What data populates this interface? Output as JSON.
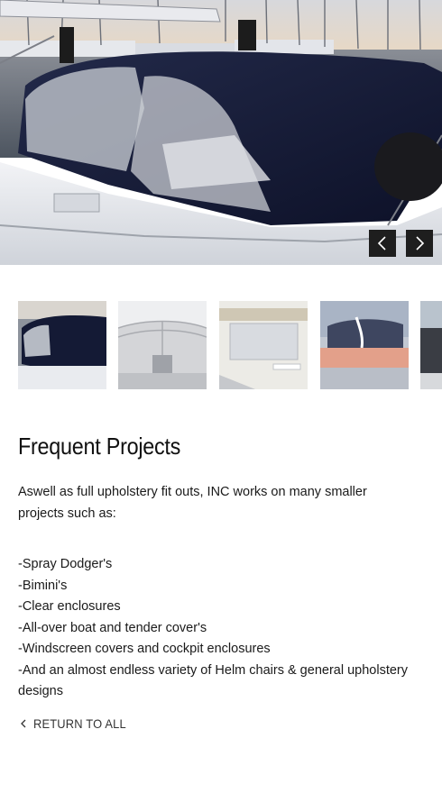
{
  "gallery": {
    "prev_icon": "chevron-left-icon",
    "next_icon": "chevron-right-icon",
    "thumbnails": [
      "dodger-cover",
      "bimini-interior",
      "clear-enclosure",
      "boat-canopy",
      "partial-thumbnail"
    ]
  },
  "content": {
    "title": "Frequent Projects",
    "intro": "Aswell as full upholstery fit outs, INC works on many smaller projects such as:",
    "list": [
      "-Spray Dodger's",
      "-Bimini's",
      "-Clear enclosures",
      "-All-over boat and tender cover's",
      "-Windscreen covers and cockpit enclosures",
      "-And an almost endless variety of Helm chairs & general upholstery designs"
    ]
  },
  "nav": {
    "return_label": "RETURN TO ALL",
    "return_icon": "chevron-left-icon"
  },
  "colors": {
    "arrow_bg": "#1e1e1e",
    "canvas_navy": "#141a35",
    "text": "#1a1a1a"
  }
}
